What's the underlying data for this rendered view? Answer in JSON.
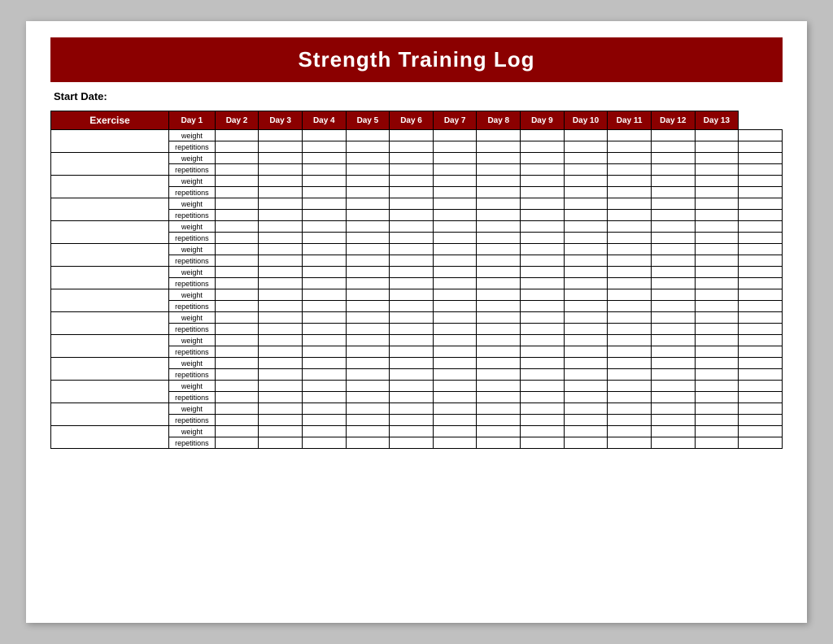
{
  "title": "Strength Training Log",
  "startDateLabel": "Start Date:",
  "headerExercise": "Exercise",
  "days": [
    "Day 1",
    "Day 2",
    "Day 3",
    "Day 4",
    "Day 5",
    "Day 6",
    "Day 7",
    "Day 8",
    "Day 9",
    "Day 10",
    "Day 11",
    "Day 12",
    "Day 13"
  ],
  "weightLabel": "weight",
  "repsLabel": "repetitions",
  "numExercises": 14
}
